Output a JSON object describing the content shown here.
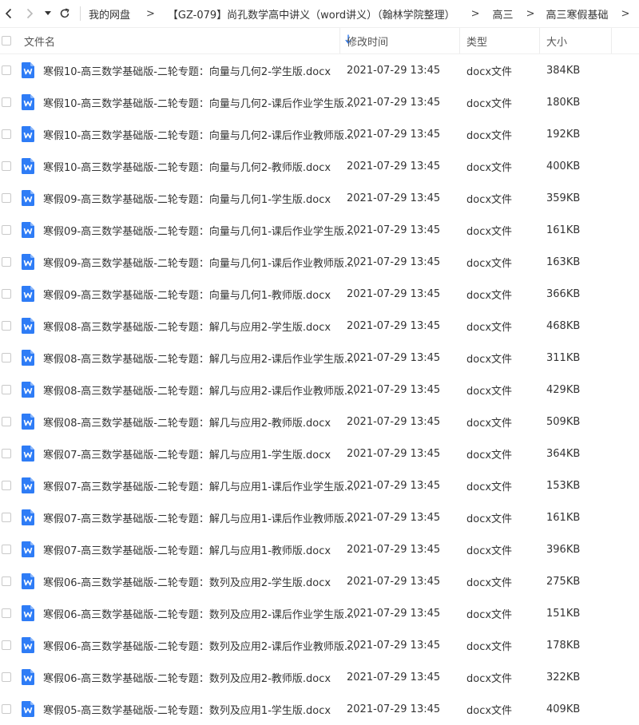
{
  "nav": {
    "back_icon": "chevron-left-icon",
    "forward_icon": "chevron-right-icon",
    "dropdown_icon": "caret-down-icon",
    "refresh_icon": "refresh-icon"
  },
  "breadcrumb": [
    {
      "label": "我的网盘"
    },
    {
      "label": "【GZ-079】尚孔数学高中讲义（word讲义）（翰林学院整理）"
    },
    {
      "label": "高三"
    },
    {
      "label": "高三寒假基础"
    }
  ],
  "breadcrumb_sep": ">",
  "columns": {
    "name": "文件名",
    "modified": "修改时间",
    "type": "类型",
    "size": "大小"
  },
  "accent_color": "#2e7cf6",
  "files": [
    {
      "name": "寒假10-高三数学基础版-二轮专题：向量与几何2-学生版.docx",
      "modified": "2021-07-29 13:45",
      "type": "docx文件",
      "size": "384KB"
    },
    {
      "name": "寒假10-高三数学基础版-二轮专题：向量与几何2-课后作业学生版....",
      "modified": "2021-07-29 13:45",
      "type": "docx文件",
      "size": "180KB"
    },
    {
      "name": "寒假10-高三数学基础版-二轮专题：向量与几何2-课后作业教师版....",
      "modified": "2021-07-29 13:45",
      "type": "docx文件",
      "size": "192KB"
    },
    {
      "name": "寒假10-高三数学基础版-二轮专题：向量与几何2-教师版.docx",
      "modified": "2021-07-29 13:45",
      "type": "docx文件",
      "size": "400KB"
    },
    {
      "name": "寒假09-高三数学基础版-二轮专题：向量与几何1-学生版.docx",
      "modified": "2021-07-29 13:45",
      "type": "docx文件",
      "size": "359KB"
    },
    {
      "name": "寒假09-高三数学基础版-二轮专题：向量与几何1-课后作业学生版....",
      "modified": "2021-07-29 13:45",
      "type": "docx文件",
      "size": "161KB"
    },
    {
      "name": "寒假09-高三数学基础版-二轮专题：向量与几何1-课后作业教师版....",
      "modified": "2021-07-29 13:45",
      "type": "docx文件",
      "size": "163KB"
    },
    {
      "name": "寒假09-高三数学基础版-二轮专题：向量与几何1-教师版.docx",
      "modified": "2021-07-29 13:45",
      "type": "docx文件",
      "size": "366KB"
    },
    {
      "name": "寒假08-高三数学基础版-二轮专题：解几与应用2-学生版.docx",
      "modified": "2021-07-29 13:45",
      "type": "docx文件",
      "size": "468KB"
    },
    {
      "name": "寒假08-高三数学基础版-二轮专题：解几与应用2-课后作业学生版....",
      "modified": "2021-07-29 13:45",
      "type": "docx文件",
      "size": "311KB"
    },
    {
      "name": "寒假08-高三数学基础版-二轮专题：解几与应用2-课后作业教师版....",
      "modified": "2021-07-29 13:45",
      "type": "docx文件",
      "size": "429KB"
    },
    {
      "name": "寒假08-高三数学基础版-二轮专题：解几与应用2-教师版.docx",
      "modified": "2021-07-29 13:45",
      "type": "docx文件",
      "size": "509KB"
    },
    {
      "name": "寒假07-高三数学基础版-二轮专题：解几与应用1-学生版.docx",
      "modified": "2021-07-29 13:45",
      "type": "docx文件",
      "size": "364KB"
    },
    {
      "name": "寒假07-高三数学基础版-二轮专题：解几与应用1-课后作业学生版....",
      "modified": "2021-07-29 13:45",
      "type": "docx文件",
      "size": "153KB"
    },
    {
      "name": "寒假07-高三数学基础版-二轮专题：解几与应用1-课后作业教师版....",
      "modified": "2021-07-29 13:45",
      "type": "docx文件",
      "size": "161KB"
    },
    {
      "name": "寒假07-高三数学基础版-二轮专题：解几与应用1-教师版.docx",
      "modified": "2021-07-29 13:45",
      "type": "docx文件",
      "size": "396KB"
    },
    {
      "name": "寒假06-高三数学基础版-二轮专题：数列及应用2-学生版.docx",
      "modified": "2021-07-29 13:45",
      "type": "docx文件",
      "size": "275KB"
    },
    {
      "name": "寒假06-高三数学基础版-二轮专题：数列及应用2-课后作业学生版....",
      "modified": "2021-07-29 13:45",
      "type": "docx文件",
      "size": "151KB"
    },
    {
      "name": "寒假06-高三数学基础版-二轮专题：数列及应用2-课后作业教师版....",
      "modified": "2021-07-29 13:45",
      "type": "docx文件",
      "size": "178KB"
    },
    {
      "name": "寒假06-高三数学基础版-二轮专题：数列及应用2-教师版.docx",
      "modified": "2021-07-29 13:45",
      "type": "docx文件",
      "size": "322KB"
    },
    {
      "name": "寒假05-高三数学基础版-二轮专题：数列及应用1-学生版.docx",
      "modified": "2021-07-29 13:45",
      "type": "docx文件",
      "size": "409KB"
    }
  ]
}
